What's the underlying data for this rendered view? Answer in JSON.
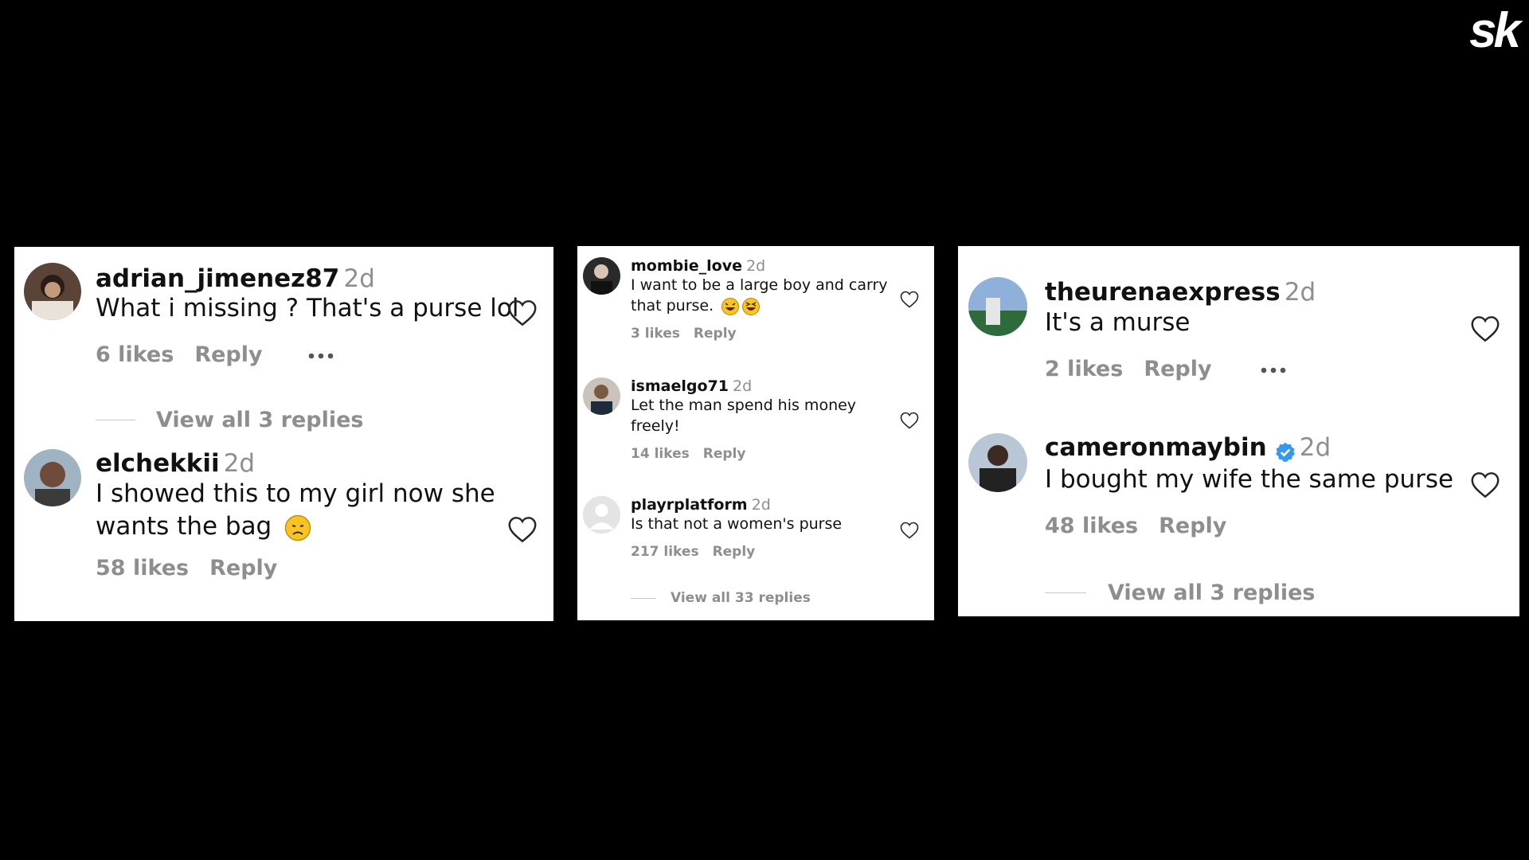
{
  "brand": {
    "logo": "sk"
  },
  "panels": [
    {
      "comments": [
        {
          "username": "adrian_jimenez87",
          "time": "2d",
          "text": "What i missing ? That's a purse lol",
          "likes": "6 likes",
          "reply": "Reply"
        },
        {
          "username": "elchekkii",
          "time": "2d",
          "text_line1": "I showed this to my girl now she",
          "text_line2": "wants the bag",
          "likes": "58 likes",
          "reply": "Reply"
        }
      ],
      "view_replies": "View all 3 replies"
    },
    {
      "comments": [
        {
          "username": "mombie_love",
          "time": "2d",
          "text_line1": "I want to be a large boy and carry",
          "text_line2": "that purse.",
          "likes": "3 likes",
          "reply": "Reply"
        },
        {
          "username": "ismaelgo71",
          "time": "2d",
          "text_line1": "Let the man spend his money",
          "text_line2": "freely!",
          "likes": "14 likes",
          "reply": "Reply"
        },
        {
          "username": "playrplatform",
          "time": "2d",
          "text": "Is that not a women's purse",
          "likes": "217 likes",
          "reply": "Reply"
        }
      ],
      "view_replies": "View all 33 replies"
    },
    {
      "comments": [
        {
          "username": "theurenaexpress",
          "time": "2d",
          "text": "It's a murse",
          "likes": "2 likes",
          "reply": "Reply"
        },
        {
          "username": "cameronmaybin",
          "time": "2d",
          "verified": true,
          "text": "I bought my wife the same purse",
          "likes": "48 likes",
          "reply": "Reply"
        }
      ],
      "view_replies": "View all 3 replies"
    }
  ],
  "icons": {
    "like": "heart-outline-icon",
    "more": "more-dots-icon",
    "verified": "verified-badge-icon"
  },
  "colors": {
    "background": "#000000",
    "panel": "#ffffff",
    "muted": "#8e8e8e",
    "verified": "#3897f0"
  }
}
